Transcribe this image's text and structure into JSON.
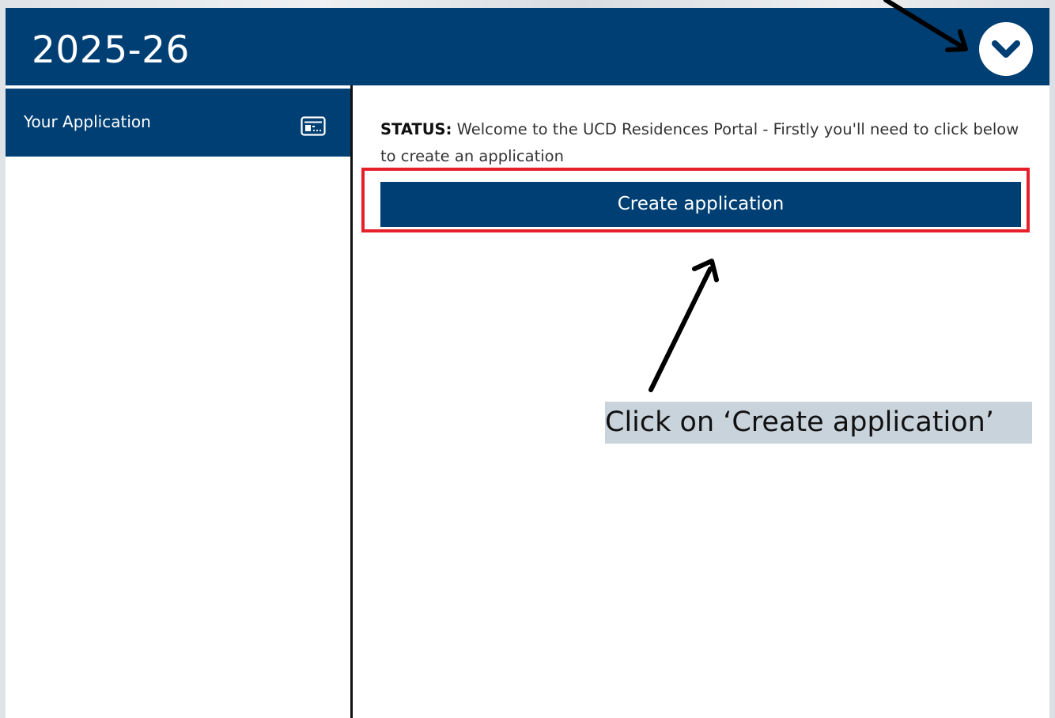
{
  "header": {
    "title": "2025-26",
    "background_color": "#003f73",
    "expand_icon": "chevron-down-icon"
  },
  "sidebar": {
    "items": [
      {
        "label": "Your Application",
        "icon": "id-card-icon",
        "active": true
      }
    ]
  },
  "content": {
    "status_label": "STATUS:",
    "status_message": " Welcome to the UCD Residences Portal - Firstly you'll need to click below to create an application",
    "create_button_label": "Create application"
  },
  "annotation": {
    "text": "Click on ‘Create application’",
    "highlight_color": "#e5202b"
  }
}
